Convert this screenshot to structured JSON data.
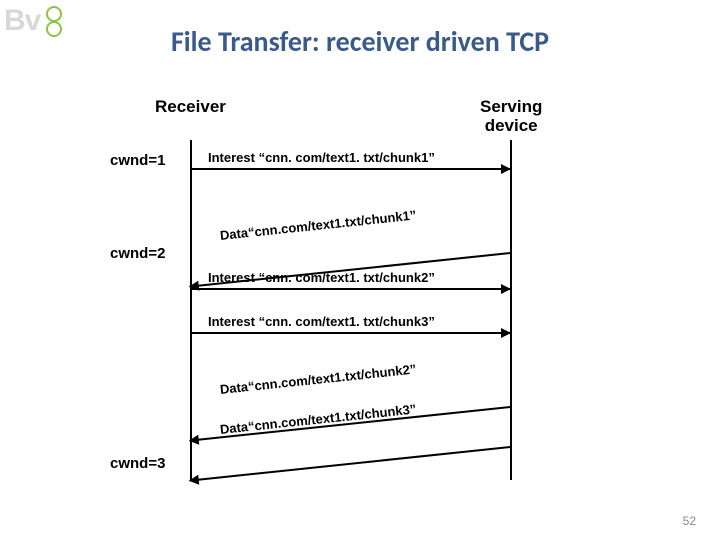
{
  "logo_text": "Bv",
  "title": "File Transfer: receiver driven TCP",
  "receiver_label": "Receiver",
  "serving_label_line1": "Serving",
  "serving_label_line2": "device",
  "cwnd": [
    "cwnd=1",
    "cwnd=2",
    "cwnd=3"
  ],
  "messages": {
    "int1": "Interest “cnn. com/text1. txt/chunk1”",
    "data1": "Data“cnn.com/text1.txt/chunk1”",
    "int2": "Interest “cnn. com/text1. txt/chunk2”",
    "int3": "Interest “cnn. com/text1. txt/chunk3”",
    "data2": "Data“cnn.com/text1.txt/chunk2”",
    "data3": "Data“cnn.com/text1.txt/chunk3”"
  },
  "page_number": "52"
}
